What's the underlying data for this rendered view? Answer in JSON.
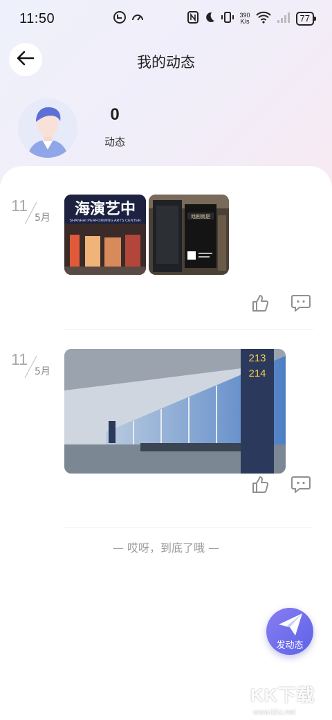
{
  "status_bar": {
    "time": "11:50",
    "speed_value": "390",
    "speed_unit": "K/s",
    "battery": "77",
    "left_icons": [
      "data-saver-icon",
      "speed-meter-icon"
    ],
    "right_icons": [
      "nfc-icon",
      "moon-icon",
      "vibrate-icon",
      "wifi-icon",
      "signal-icon"
    ]
  },
  "header": {
    "title": "我的动态",
    "back_icon": "arrow-left-icon"
  },
  "profile": {
    "count": "0",
    "count_label": "动态"
  },
  "posts": [
    {
      "day": "11",
      "month": "5月",
      "photos": [
        {
          "text": "海演艺中",
          "subtext": "SHANHAI PERFORMING ARTS CENTER",
          "scene": "performing-arts-center-facade"
        },
        {
          "text": "戏剧就是",
          "scene": "theater-poster-display"
        }
      ],
      "like_icon": "thumbs-up-icon",
      "comment_icon": "comment-icon"
    },
    {
      "day": "11",
      "month": "5月",
      "photos": [
        {
          "gate_a": "213",
          "gate_b": "214",
          "scene": "airport-terminal-hall"
        }
      ],
      "like_icon": "thumbs-up-icon",
      "comment_icon": "comment-icon"
    }
  ],
  "footer": {
    "end_text": "— 哎呀，到底了哦 —"
  },
  "fab": {
    "label": "发动态",
    "icon": "paper-plane-icon"
  },
  "watermark": {
    "brand": "KK下载",
    "url": "www.kkx.net"
  },
  "colors": {
    "accent": "#6a6ff0",
    "muted_text": "#a9a9a9",
    "background_top": "#eef0fb"
  }
}
